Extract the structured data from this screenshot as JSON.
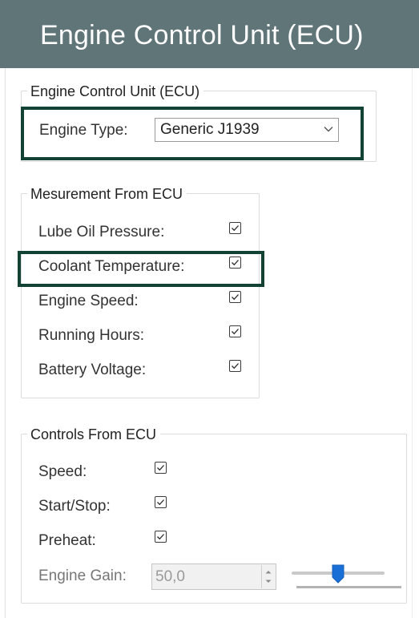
{
  "window": {
    "title": "Engine Control Unit (ECU)"
  },
  "ecu_group": {
    "title": "Engine Control Unit (ECU)",
    "engine_type_label": "Engine Type:",
    "engine_type_value": "Generic J1939"
  },
  "measurement_group": {
    "title": "Mesurement From ECU",
    "items": [
      {
        "label": "Lube Oil Pressure:",
        "checked": true
      },
      {
        "label": "Coolant Temperature:",
        "checked": true
      },
      {
        "label": "Engine Speed:",
        "checked": true
      },
      {
        "label": "Running Hours:",
        "checked": true
      },
      {
        "label": "Battery Voltage:",
        "checked": true
      }
    ]
  },
  "controls_group": {
    "title": "Controls From ECU",
    "items": [
      {
        "label": "Speed:",
        "checked": true
      },
      {
        "label": "Start/Stop:",
        "checked": true
      },
      {
        "label": "Preheat:",
        "checked": true
      }
    ],
    "gain_label": "Engine Gain:",
    "gain_value": "50,0"
  },
  "colors": {
    "title_bar": "#607578",
    "highlight": "#124234",
    "slider_thumb": "#1a6fd6"
  },
  "icons": [
    "chevron-down-icon",
    "checkmark-icon",
    "spin-up-icon",
    "spin-down-icon",
    "slider-thumb"
  ]
}
